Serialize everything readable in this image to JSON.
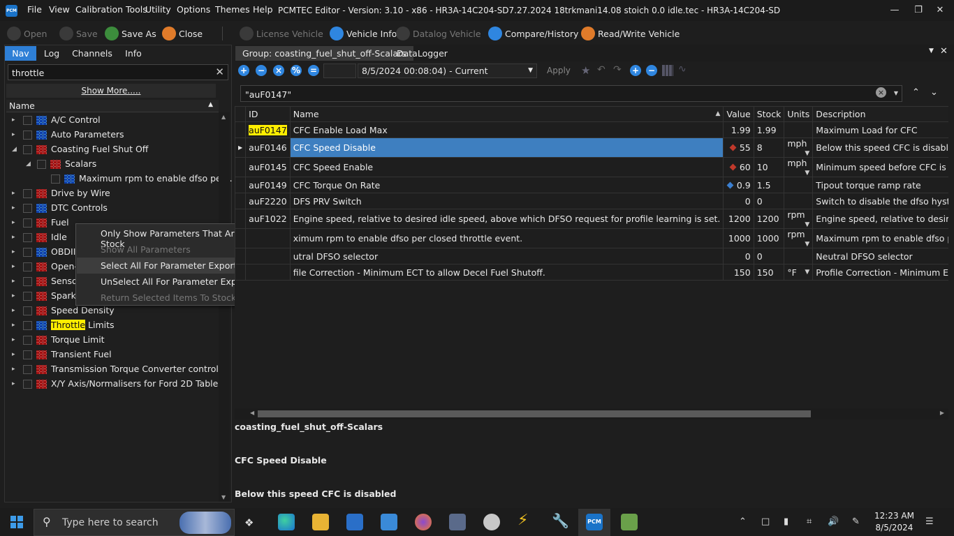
{
  "app": {
    "logo_text": "PCM",
    "title": "PCMTEC Editor - Version: 3.10 - x86 - HR3A-14C204-SD7.27.2024 18trkmani14.08 stoich 0.0 idle.tec - HR3A-14C204-SD"
  },
  "menu": [
    "File",
    "View",
    "Calibration Tools",
    "Utility",
    "Options",
    "Themes",
    "Help"
  ],
  "toolbar": {
    "open": "Open",
    "save": "Save",
    "save_as": "Save As",
    "close": "Close",
    "license_vehicle": "License Vehicle",
    "vehicle_info": "Vehicle Info",
    "datalog_vehicle": "Datalog Vehicle",
    "compare_history": "Compare/History",
    "read_write_vehicle": "Read/Write Vehicle"
  },
  "left": {
    "tabs": [
      "Nav",
      "Log",
      "Channels",
      "Info"
    ],
    "search_value": "throttle",
    "show_more": "Show More.....",
    "tree_header": "Name",
    "tree": [
      {
        "label": "A/C Control",
        "icon": "blue"
      },
      {
        "label": "Auto Parameters",
        "icon": "blue"
      },
      {
        "label": "Coasting Fuel Shut Off",
        "icon": "red"
      },
      {
        "label": "Scalars",
        "icon": "red"
      },
      {
        "label": "Maximum rpm to enable dfso per...",
        "icon": "blue"
      },
      {
        "label": "Drive by Wire",
        "icon": "red"
      },
      {
        "label": "DTC Controls",
        "icon": "blue"
      },
      {
        "label": "Fuel",
        "icon": "red"
      },
      {
        "label": "Idle",
        "icon": "red"
      },
      {
        "label": "OBDII",
        "icon": "blue"
      },
      {
        "label": "Open-",
        "icon": "red"
      },
      {
        "label": "Sensor",
        "icon": "red"
      },
      {
        "label": "Spark",
        "icon": "red"
      },
      {
        "label": "Speed Density",
        "icon": "red"
      },
      {
        "label_hl": "Throttle",
        "label_rest": " Limits",
        "icon": "blue"
      },
      {
        "label": "Torque Limit",
        "icon": "red"
      },
      {
        "label": "Transient Fuel",
        "icon": "red"
      },
      {
        "label": "Transmission Torque Converter control",
        "icon": "red"
      },
      {
        "label": "X/Y Axis/Normalisers for Ford 2D Tables",
        "icon": "red"
      }
    ],
    "context_menu": [
      "Only Show Parameters That Are Different To Stock",
      "Show All Parameters",
      "Select All For Parameter Export",
      "UnSelect All For Parameter Export",
      "Return Selected Items To Stock"
    ]
  },
  "right": {
    "tabs": [
      "Group: coasting_fuel_shut_off-Scalars",
      "DataLogger"
    ],
    "date_select": "8/5/2024 00:08:04) - Current",
    "apply": "Apply",
    "filter_value": "\"auF0147\"",
    "columns": [
      "ID",
      "Name",
      "Value",
      "Stock",
      "Units",
      "Description"
    ],
    "rows": [
      {
        "id": "auF0147",
        "name": "CFC Enable Load Max",
        "value": "1.99",
        "stock": "1.99",
        "units": "",
        "desc": "Maximum Load for CFC"
      },
      {
        "id": "auF0146",
        "name": "CFC Speed Disable",
        "value": "55",
        "stock": "8",
        "units": "mph",
        "desc": "Below this speed CFC is disabled"
      },
      {
        "id": "auF0145",
        "name": "CFC Speed Enable",
        "value": "60",
        "stock": "10",
        "units": "mph",
        "desc": "Minimum speed before CFC is enabled"
      },
      {
        "id": "auF0149",
        "name": "CFC Torque On Rate",
        "value": "0.9",
        "stock": "1.5",
        "units": "",
        "desc": "Tipout torque ramp rate"
      },
      {
        "id": "auF2220",
        "name": "DFS PRV Switch",
        "value": "0",
        "stock": "0",
        "units": "",
        "desc": "Switch to disable the dfso hysteresis term DFS_PRV_FLG"
      },
      {
        "id": "auF1022",
        "name": "Engine speed, relative to desired idle speed, above which DFSO request for profile learning is set.",
        "value": "1200",
        "stock": "1200",
        "units": "rpm",
        "desc": "Engine speed, relative to desired idle speed, above which"
      },
      {
        "id": "",
        "name": "ximum rpm to enable dfso per closed throttle event.",
        "value": "1000",
        "stock": "1000",
        "units": "rpm",
        "desc": "Maximum rpm to enable dfso per closed throttle event."
      },
      {
        "id": "",
        "name": "utral DFSO selector",
        "value": "0",
        "stock": "0",
        "units": "",
        "desc": "Neutral DFSO selector"
      },
      {
        "id": "",
        "name": "file Correction - Minimum ECT to allow Decel Fuel Shutoff.",
        "value": "150",
        "stock": "150",
        "units": "°F",
        "desc": "Profile Correction - Minimum ECT to allow Decel Fuel Sh"
      }
    ],
    "info_group": "coasting_fuel_shut_off-Scalars",
    "info_name": "CFC Speed Disable",
    "info_desc": "Below this speed CFC is disabled"
  },
  "taskbar": {
    "search_placeholder": "Type here to search",
    "time": "12:23 AM",
    "date": "8/5/2024"
  }
}
